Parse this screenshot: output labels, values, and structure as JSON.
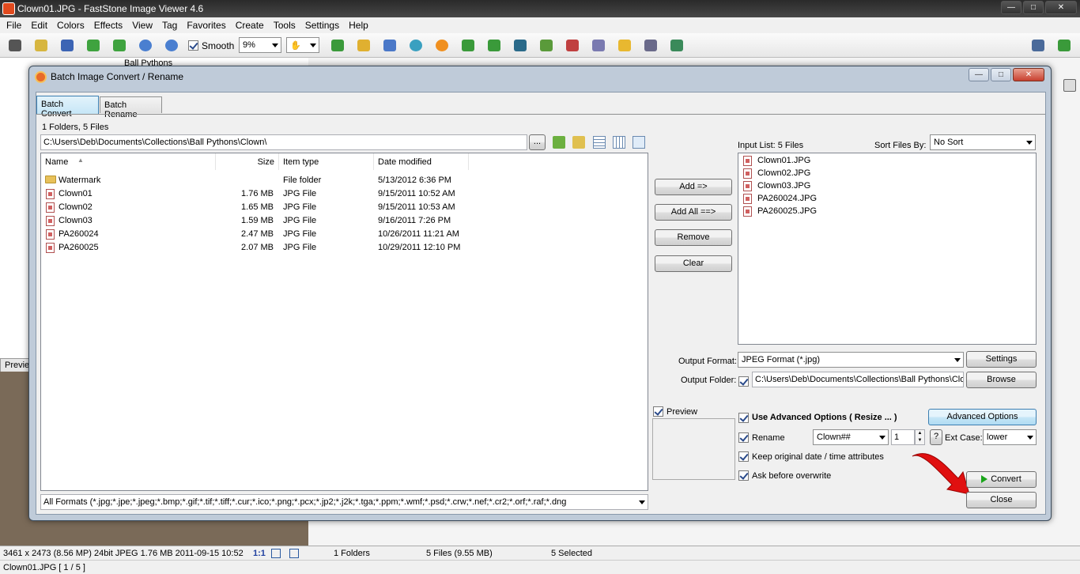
{
  "app": {
    "title": "Clown01.JPG - FastStone Image Viewer 4.6",
    "menu": [
      "File",
      "Edit",
      "Colors",
      "Effects",
      "View",
      "Tag",
      "Favorites",
      "Create",
      "Tools",
      "Settings",
      "Help"
    ],
    "toolbar": {
      "smooth_label": "Smooth",
      "zoom_value": "9%"
    },
    "bg_tree_label": "Ball Pythons",
    "bg_preview_label": "Previe"
  },
  "dialog": {
    "title": "Batch Image Convert / Rename",
    "tabs": [
      "Batch Convert",
      "Batch Rename"
    ],
    "folder_summary": "1 Folders, 5 Files",
    "path": "C:\\Users\\Deb\\Documents\\Collections\\Ball Pythons\\Clown\\",
    "browse_dots": "...",
    "columns": {
      "name": "Name",
      "size": "Size",
      "type": "Item type",
      "date": "Date modified"
    },
    "files": [
      {
        "name": "Watermark",
        "size": "",
        "type": "File folder",
        "date": "5/13/2012 6:36 PM",
        "folder": true
      },
      {
        "name": "Clown01",
        "size": "1.76 MB",
        "type": "JPG File",
        "date": "9/15/2011 10:52 AM"
      },
      {
        "name": "Clown02",
        "size": "1.65 MB",
        "type": "JPG File",
        "date": "9/15/2011 10:53 AM"
      },
      {
        "name": "Clown03",
        "size": "1.59 MB",
        "type": "JPG File",
        "date": "9/16/2011 7:26 PM"
      },
      {
        "name": "PA260024",
        "size": "2.47 MB",
        "type": "JPG File",
        "date": "10/26/2011 11:21 AM"
      },
      {
        "name": "PA260025",
        "size": "2.07 MB",
        "type": "JPG File",
        "date": "10/29/2011 12:10 PM"
      }
    ],
    "filter": "All Formats (*.jpg;*.jpe;*.jpeg;*.bmp;*.gif;*.tif;*.tiff;*.cur;*.ico;*.png;*.pcx;*.jp2;*.j2k;*.tga;*.ppm;*.wmf;*.psd;*.crw;*.nef;*.cr2;*.orf;*.raf;*.dng",
    "buttons": {
      "add": "Add =>",
      "add_all": "Add All ==>",
      "remove": "Remove",
      "clear": "Clear",
      "settings": "Settings",
      "browse": "Browse",
      "advanced": "Advanced Options",
      "convert": "Convert",
      "close": "Close",
      "help": "?"
    },
    "input_list_label": "Input List:  5 Files",
    "sort_label": "Sort Files By:",
    "sort_value": "No Sort",
    "input_files": [
      "Clown01.JPG",
      "Clown02.JPG",
      "Clown03.JPG",
      "PA260024.JPG",
      "PA260025.JPG"
    ],
    "output_format_label": "Output Format:",
    "output_format_value": "JPEG Format (*.jpg)",
    "output_folder_label": "Output Folder:",
    "output_folder_value": "C:\\Users\\Deb\\Documents\\Collections\\Ball Pythons\\Clov",
    "preview_label": "Preview",
    "use_advanced_label": "Use Advanced Options ( Resize ... )",
    "rename_label": "Rename",
    "rename_pattern": "Clown##",
    "rename_start": "1",
    "ext_case_label": "Ext Case:",
    "ext_case_value": "lower",
    "keep_date_label": "Keep original date / time attributes",
    "ask_overwrite_label": "Ask before overwrite"
  },
  "status": {
    "image_info": "3461 x 2473 (8.56 MP)  24bit  JPEG   1.76 MB   2011-09-15 10:52",
    "ratio": "1:1",
    "folders": "1 Folders",
    "files": "5 Files (9.55 MB)",
    "selected": "5 Selected",
    "bottom": "Clown01.JPG [ 1 / 5 ]"
  },
  "colors": {
    "accent_blue": "#3c7fb1",
    "arrow_red": "#e01010",
    "convert_green": "#1aa51a"
  }
}
